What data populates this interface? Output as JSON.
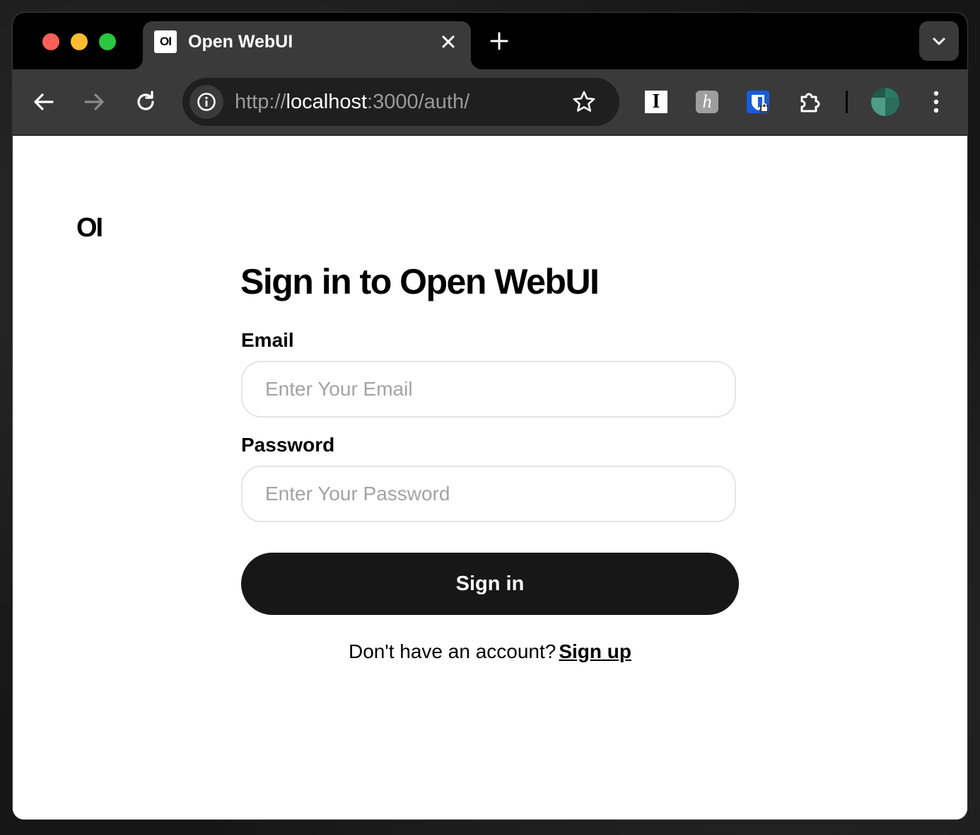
{
  "browser": {
    "tab": {
      "favicon_text": "OI",
      "title": "Open WebUI"
    },
    "omnibox": {
      "url_scheme": "http://",
      "url_host": "localhost",
      "url_rest": ":3000/auth/"
    },
    "extensions": {
      "instapaper_glyph": "I",
      "hypothesis_glyph": "h"
    },
    "icons": [
      "close-icon",
      "plus-icon",
      "chevron-down-icon",
      "back-arrow-icon",
      "forward-arrow-icon",
      "reload-icon",
      "info-icon",
      "star-icon",
      "puzzle-icon",
      "kebab-menu-icon"
    ]
  },
  "page": {
    "logo_text": "OI",
    "heading": "Sign in to Open WebUI",
    "email": {
      "label": "Email",
      "placeholder": "Enter Your Email",
      "value": ""
    },
    "password": {
      "label": "Password",
      "placeholder": "Enter Your Password",
      "value": ""
    },
    "submit_label": "Sign in",
    "signup_prompt": "Don't have an account?",
    "signup_link": "Sign up"
  },
  "colors": {
    "button_bg": "#171717",
    "field_border": "#e5e5e5",
    "placeholder": "#a3a3a3",
    "tab_bg": "#3a3a3a",
    "omnibox_bg": "#1f1f1f"
  }
}
